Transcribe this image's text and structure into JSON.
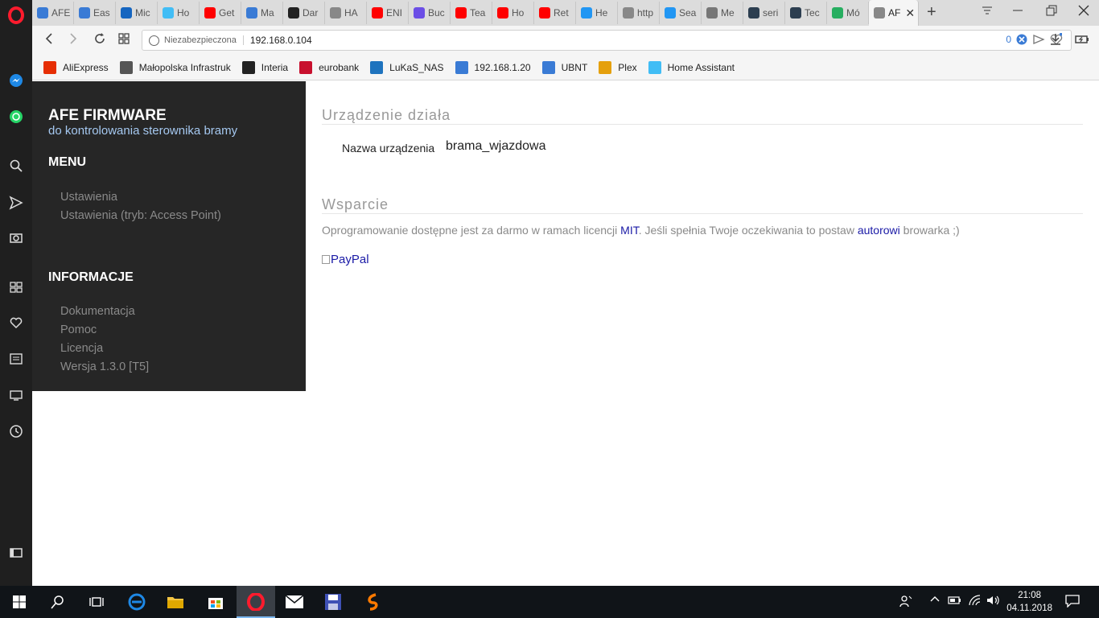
{
  "tabs": [
    {
      "label": "AFE",
      "color": "#3a7bd5"
    },
    {
      "label": "Eas",
      "color": "#3a7bd5"
    },
    {
      "label": "Mic",
      "color": "#1565c0"
    },
    {
      "label": "Ho",
      "color": "#41bdf5"
    },
    {
      "label": "Get",
      "color": "#ff0000"
    },
    {
      "label": "Ma",
      "color": "#3a7bd5"
    },
    {
      "label": "Dar",
      "color": "#222222"
    },
    {
      "label": "HA",
      "color": "#888888"
    },
    {
      "label": "ENI",
      "color": "#ff0000"
    },
    {
      "label": "Buc",
      "color": "#6b4ee6"
    },
    {
      "label": "Tea",
      "color": "#ff0000"
    },
    {
      "label": "Ho",
      "color": "#ff0000"
    },
    {
      "label": "Ret",
      "color": "#ff0000"
    },
    {
      "label": "He",
      "color": "#2196f3"
    },
    {
      "label": "http",
      "color": "#888888"
    },
    {
      "label": "Sea",
      "color": "#2196f3"
    },
    {
      "label": "Me",
      "color": "#777777"
    },
    {
      "label": "seri",
      "color": "#2c3e50"
    },
    {
      "label": "Tec",
      "color": "#2c3e50"
    },
    {
      "label": "Mó",
      "color": "#27ae60"
    },
    {
      "label": "AF",
      "color": "#888888",
      "active": true
    }
  ],
  "address_bar": {
    "security_label": "Niezabezpieczona",
    "url": "192.168.0.104",
    "badge_count": "0"
  },
  "bookmarks": [
    {
      "label": "AliExpress",
      "color": "#e62e04"
    },
    {
      "label": "Małopolska Infrastruk",
      "color": "#555555"
    },
    {
      "label": "Interia",
      "color": "#222222"
    },
    {
      "label": "eurobank",
      "color": "#c8102e"
    },
    {
      "label": "LuKaS_NAS",
      "color": "#1e73be"
    },
    {
      "label": "192.168.1.20",
      "color": "#3a7bd5"
    },
    {
      "label": "UBNT",
      "color": "#3a7bd5"
    },
    {
      "label": "Plex",
      "color": "#e5a00d"
    },
    {
      "label": "Home Assistant",
      "color": "#41bdf5"
    }
  ],
  "sidebar": {
    "title": "AFE FIRMWARE",
    "subtitle": "do kontrolowania sterownika bramy",
    "menu_heading": "MENU",
    "menu_items": [
      "Ustawienia",
      "Ustawienia (tryb: Access Point)"
    ],
    "info_heading": "INFORMACJE",
    "info_items": [
      "Dokumentacja",
      "Pomoc",
      "Licencja",
      "Wersja 1.3.0 [T5]"
    ]
  },
  "main": {
    "status_title": "Urządzenie działa",
    "device_name_label": "Nazwa urządzenia",
    "device_name_value": "brama_wjazdowa",
    "support_title": "Wsparcie",
    "support_text_1": "Oprogramowanie dostępne jest za darmo w ramach licencji ",
    "support_link_mit": "MIT",
    "support_text_2": ". Jeśli spełnia Twoje oczekiwania to postaw ",
    "support_link_author": "autorowi",
    "support_text_3": " browarka ;)",
    "paypal_alt": "PayPal"
  },
  "taskbar": {
    "time": "21:08",
    "date": "04.11.2018"
  }
}
